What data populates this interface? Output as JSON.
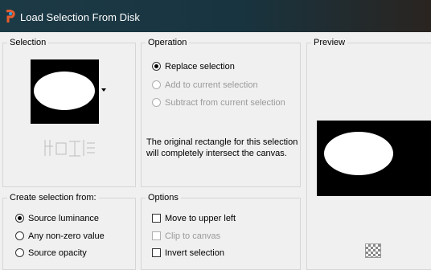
{
  "window": {
    "title": "Load Selection From Disk",
    "app_icon": "paintshop-pro-icon"
  },
  "selection_group": {
    "label": "Selection",
    "thumbnail_dropdown_icon": "chevron-down-icon"
  },
  "operation_group": {
    "label": "Operation",
    "options": [
      {
        "label": "Replace selection",
        "checked": true,
        "enabled": true
      },
      {
        "label": "Add to current selection",
        "checked": false,
        "enabled": false
      },
      {
        "label": "Subtract from current selection",
        "checked": false,
        "enabled": false
      }
    ],
    "info": "The original rectangle for this selection will completely intersect the canvas."
  },
  "preview_group": {
    "label": "Preview",
    "toggle_icon": "checkerboard-icon"
  },
  "create_from_group": {
    "label": "Create selection from:",
    "options": [
      {
        "label": "Source luminance",
        "checked": true
      },
      {
        "label": "Any non-zero value",
        "checked": false
      },
      {
        "label": "Source opacity",
        "checked": false
      }
    ]
  },
  "options_group": {
    "label": "Options",
    "items": [
      {
        "label": "Move to upper left",
        "checked": false,
        "enabled": true
      },
      {
        "label": "Clip to canvas",
        "checked": false,
        "enabled": false
      },
      {
        "label": "Invert selection",
        "checked": false,
        "enabled": true
      }
    ]
  },
  "colors": {
    "titlebar": "#1c3a46",
    "dialog_bg": "#f0f0f0",
    "group_border": "#d6d6d6",
    "disabled_text": "#9a9a9a"
  }
}
